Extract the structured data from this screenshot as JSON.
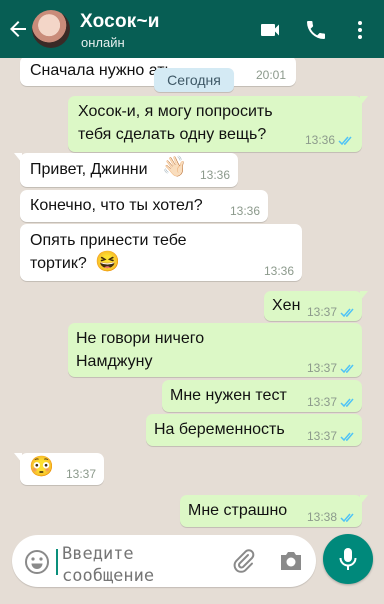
{
  "header": {
    "contact_name": "Хосок~и",
    "status": "онлайн"
  },
  "date_chip": "Сегодня",
  "messages": [
    {
      "dir": "in",
      "text": "Сначала нужно                    ать",
      "time": "20:01",
      "ticks": false
    },
    {
      "dir": "out",
      "text_lines": [
        "Хосок-и, я могу попросить",
        "тебя сделать одну вещь?"
      ],
      "time": "13:36",
      "ticks": true
    },
    {
      "dir": "in",
      "text": "Привет, Джинни",
      "emoji": "👋🏻",
      "time": "13:36",
      "ticks": false
    },
    {
      "dir": "in",
      "text": "Конечно, что ты хотел?",
      "time": "13:36",
      "ticks": false
    },
    {
      "dir": "in",
      "text_lines": [
        "Опять принести тебе",
        "тортик?"
      ],
      "emoji": "😆",
      "time": "13:36",
      "ticks": false
    },
    {
      "dir": "out",
      "text": "Хен",
      "time": "13:37",
      "ticks": true
    },
    {
      "dir": "out",
      "text_lines": [
        "Не говори ничего",
        "Намджуну"
      ],
      "time": "13:37",
      "ticks": true
    },
    {
      "dir": "out",
      "text": "Мне нужен тест",
      "time": "13:37",
      "ticks": true
    },
    {
      "dir": "out",
      "text": "На беременность",
      "time": "13:37",
      "ticks": true
    },
    {
      "dir": "in",
      "emoji": "😳",
      "time": "13:37",
      "ticks": false
    },
    {
      "dir": "out",
      "text": "Мне страшно",
      "time": "13:38",
      "ticks": true
    }
  ],
  "input": {
    "placeholder": "Введите сообщение"
  },
  "colors": {
    "header": "#075e54",
    "incoming_bubble": "#ffffff",
    "outgoing_bubble": "#dcf8c6",
    "read_ticks": "#4fc3f7",
    "mic_button": "#00897b"
  },
  "icons": {
    "back": "arrow-left-icon",
    "video": "video-camera-icon",
    "call": "phone-icon",
    "menu": "more-vertical-icon",
    "emoji": "emoji-smile-icon",
    "attach": "paperclip-icon",
    "camera": "camera-icon",
    "mic": "microphone-icon"
  }
}
